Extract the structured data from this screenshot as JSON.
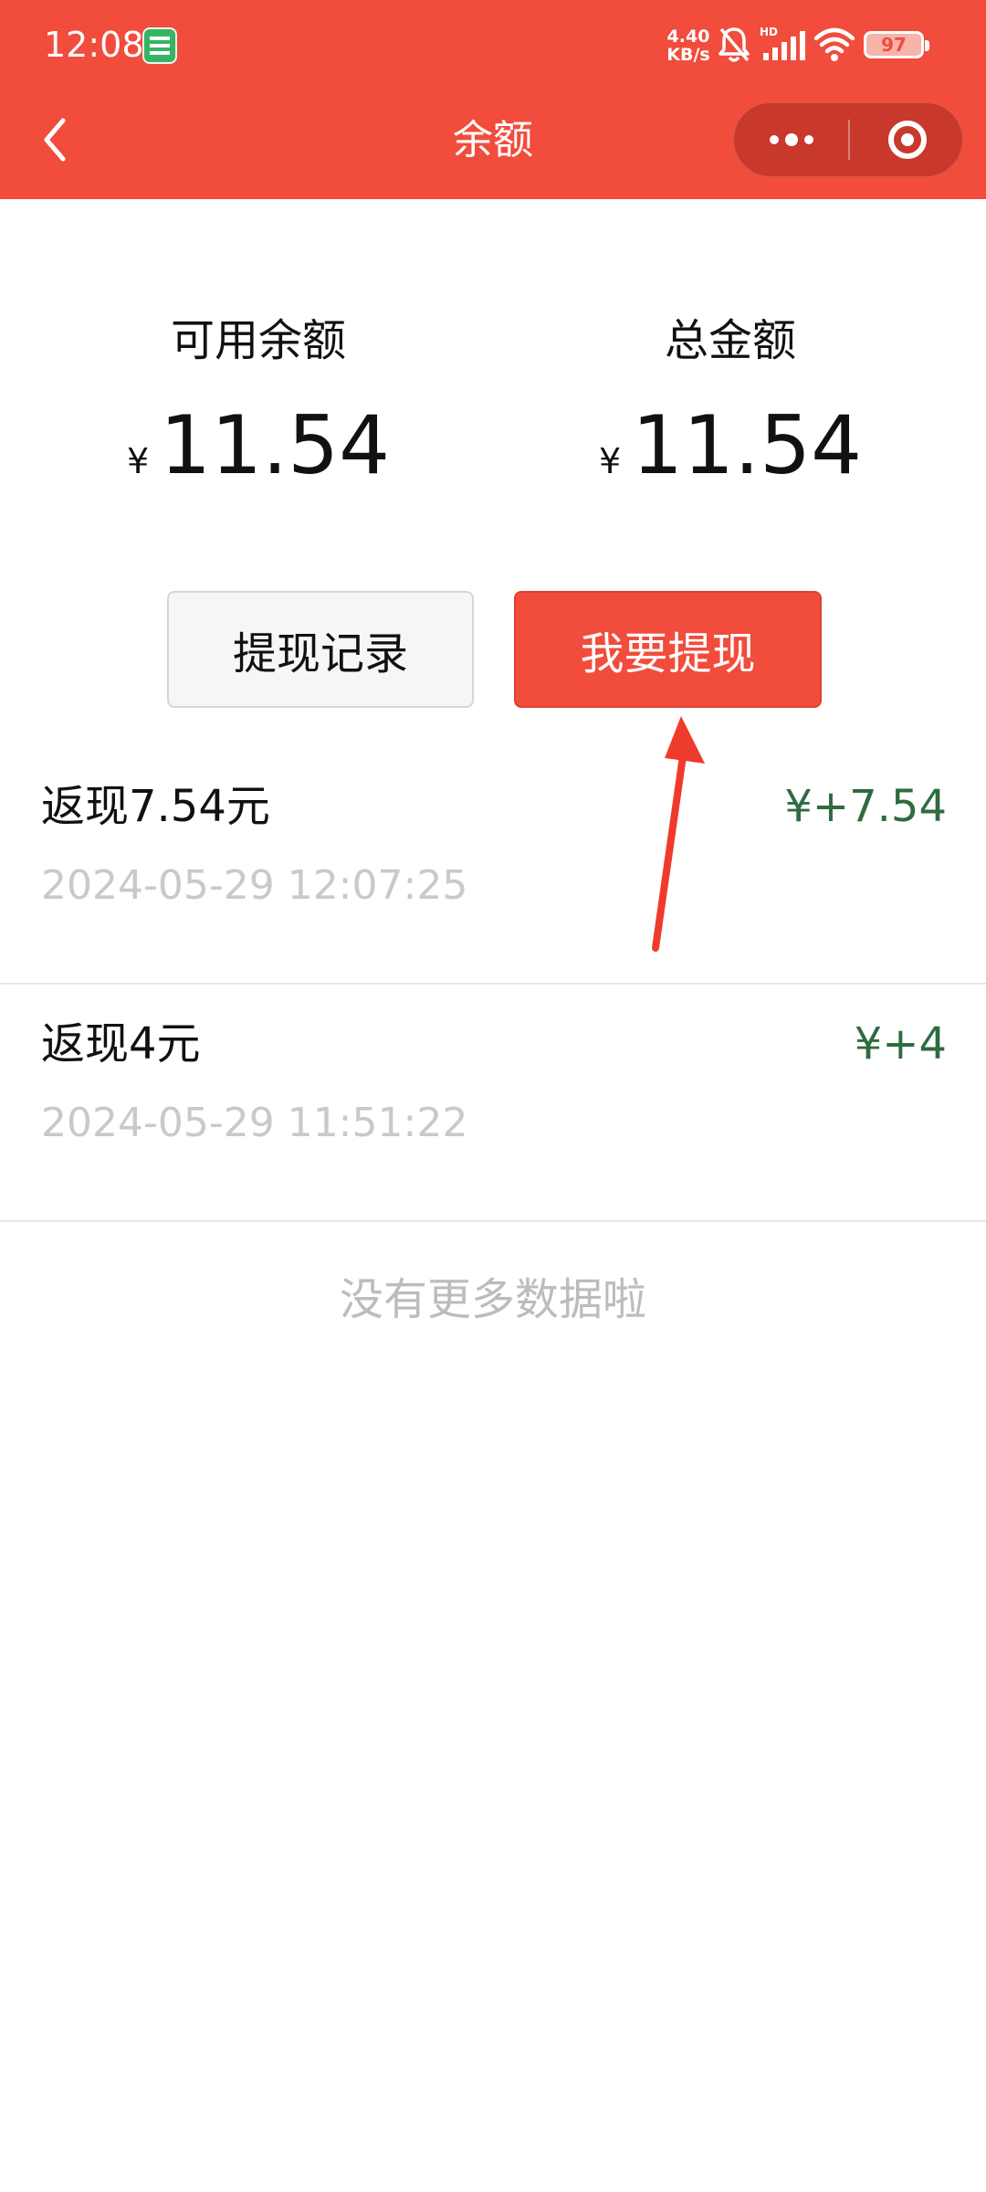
{
  "status_bar": {
    "time": "12:08",
    "net_speed_value": "4.40",
    "net_speed_unit": "KB/s",
    "battery": "97",
    "icons": [
      "mini-app-badge-icon",
      "mute-bell-icon",
      "hd-signal-icon",
      "wifi-icon",
      "battery-icon"
    ]
  },
  "nav": {
    "title": "余额",
    "back_icon": "chevron-left-icon",
    "more_icon": "more-dots-icon",
    "close_icon": "target-circle-icon"
  },
  "balance": {
    "available_label": "可用余额",
    "available_currency": "¥",
    "available_amount": "11.54",
    "total_label": "总金额",
    "total_currency": "¥",
    "total_amount": "11.54"
  },
  "actions": {
    "history_label": "提现记录",
    "withdraw_label": "我要提现"
  },
  "transactions": [
    {
      "title": "返现7.54元",
      "time": "2024-05-29 12:07:25",
      "amount": "¥+7.54"
    },
    {
      "title": "返现4元",
      "time": "2024-05-29 11:51:22",
      "amount": "¥+4"
    }
  ],
  "footer": {
    "no_more": "没有更多数据啦"
  },
  "colors": {
    "brand": "#f14c3c",
    "positive_amount": "#2f6b3f",
    "muted_text": "#c9c9c9"
  }
}
